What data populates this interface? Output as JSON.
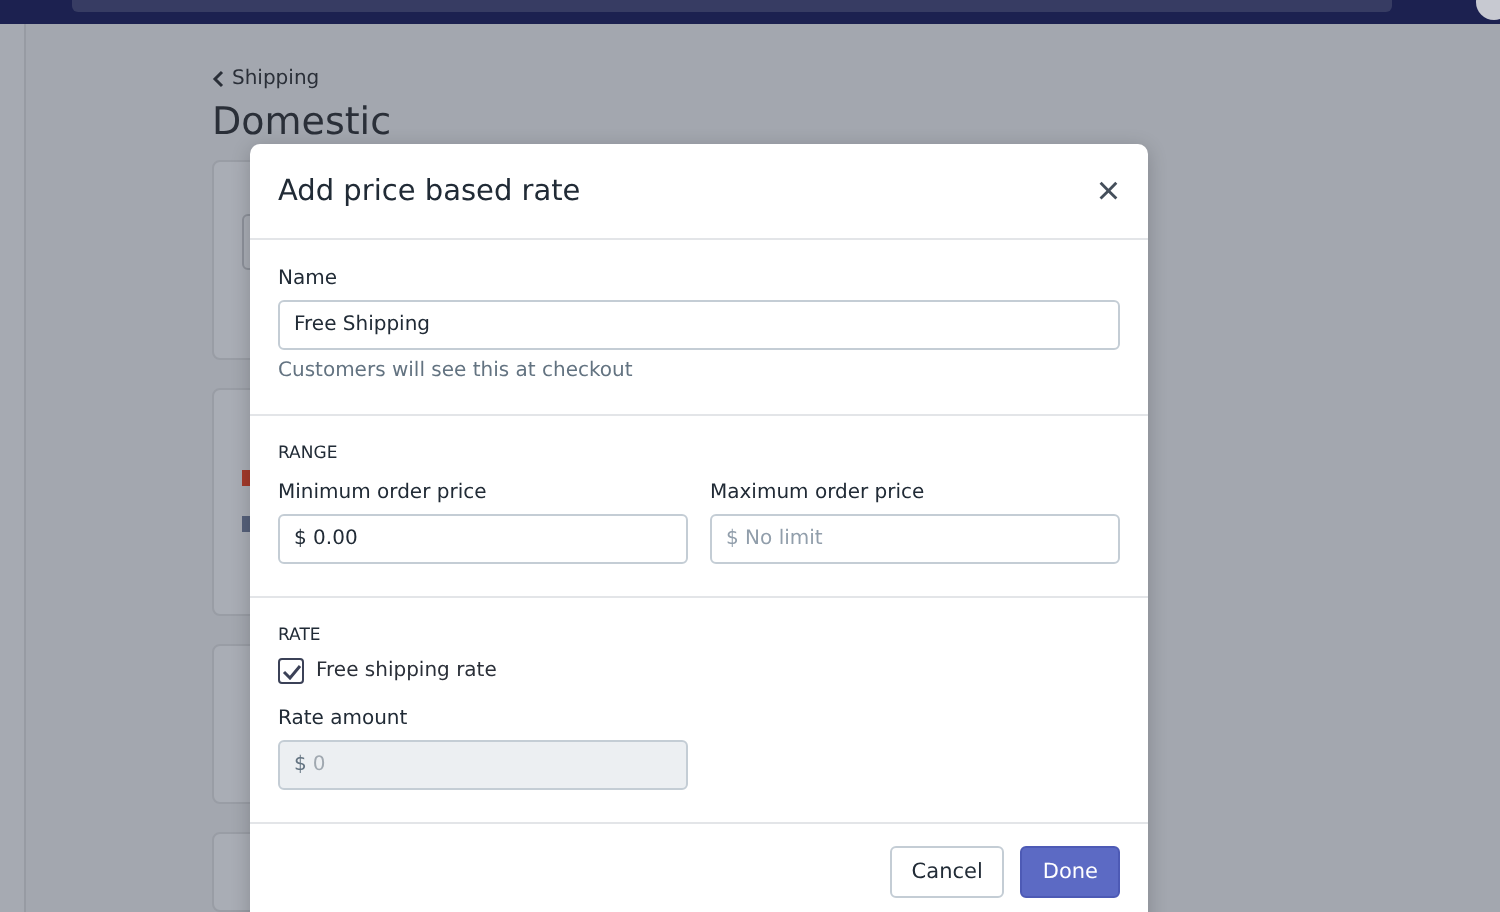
{
  "back_link": "Shipping",
  "page_title": "Domestic",
  "background_cards": [
    {
      "kind": "field"
    },
    {
      "kind": "flags"
    },
    {
      "kind": "text"
    },
    {
      "kind": "empty"
    }
  ],
  "dialog": {
    "title": "Add price based rate",
    "close": "×",
    "name_label": "Name",
    "name_value": "Free Shipping",
    "name_help": "Customers will see this at checkout",
    "range_heading": "RANGE",
    "min_label": "Minimum order price",
    "min_value": "$ 0.00",
    "max_label": "Maximum order price",
    "max_placeholder": "$ No limit",
    "rate_heading": "RATE",
    "free_label": "Free shipping rate",
    "free_checked": true,
    "amount_label": "Rate amount",
    "amount_prefix": "$",
    "amount_placeholder": "0",
    "amount_disabled": true,
    "buttons": [
      {
        "label": "Cancel",
        "kind": "secondary"
      },
      {
        "label": "Done",
        "kind": "primary"
      }
    ]
  }
}
